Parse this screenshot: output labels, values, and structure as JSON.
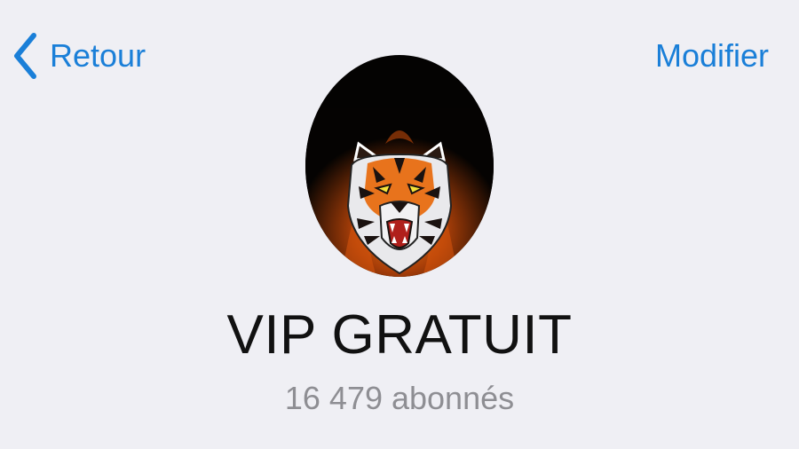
{
  "nav": {
    "back_label": "Retour",
    "edit_label": "Modifier"
  },
  "channel": {
    "name": "VIP GRATUIT",
    "subscribers": "16 479 abonnés"
  },
  "colors": {
    "accent": "#1a7fd8",
    "background": "#efeff4",
    "title": "#111111",
    "secondary": "#8e8e93"
  },
  "icons": {
    "back": "chevron-left-icon",
    "avatar": "tiger-logo"
  }
}
